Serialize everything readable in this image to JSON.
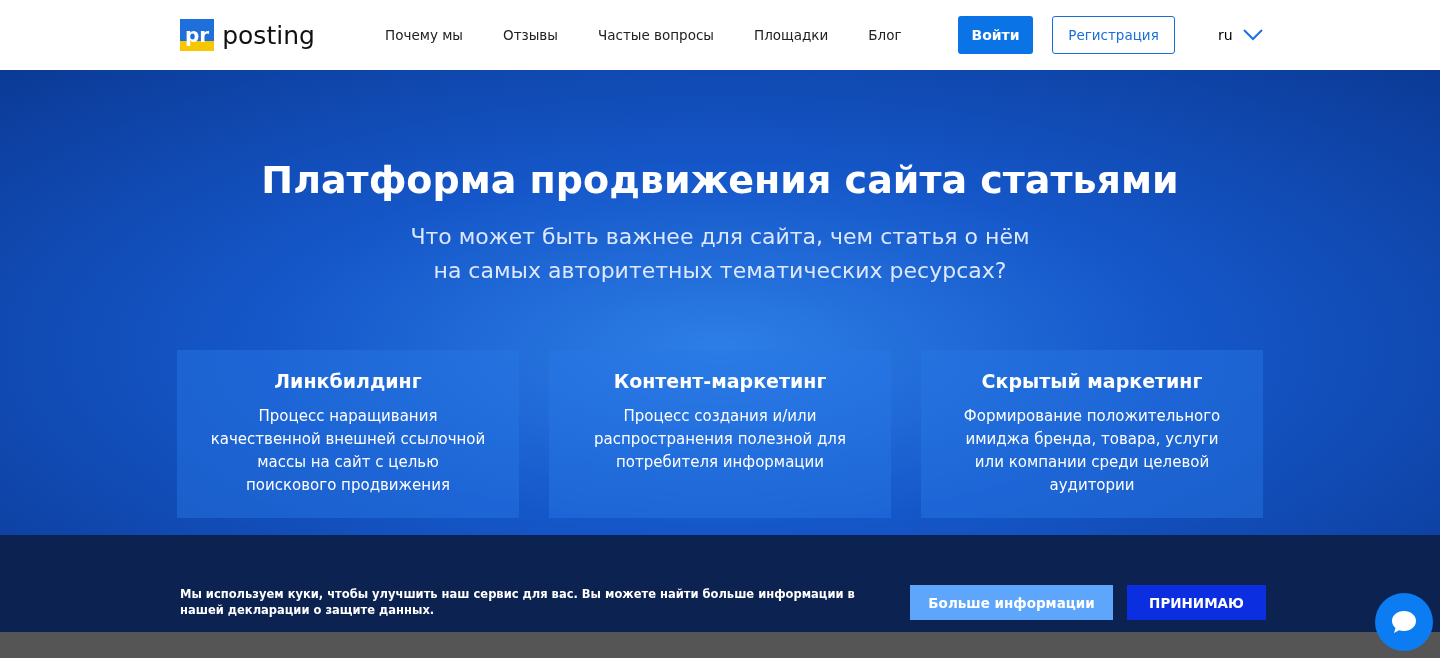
{
  "header": {
    "logo": {
      "mark": "pr",
      "name": "posting"
    },
    "nav": [
      {
        "label": "Почему мы"
      },
      {
        "label": "Отзывы"
      },
      {
        "label": "Частые вопросы"
      },
      {
        "label": "Площадки"
      },
      {
        "label": "Блог"
      }
    ],
    "login": "Войти",
    "register": "Регистрация",
    "language": "ru"
  },
  "hero": {
    "title": "Платформа продвижения сайта статьями",
    "subtitle_lines": [
      "Что может быть важнее для сайта, чем статья о нём",
      "на самых авторитетных тематических ресурсах?"
    ],
    "cards": [
      {
        "title": "Линкбилдинг",
        "text": "Процесс наращивания качественной внешней ссылочной массы на сайт с целью поискового продвижения"
      },
      {
        "title": "Контент-маркетинг",
        "text": "Процесс создания и/или распространения полезной для потребителя информации"
      },
      {
        "title": "Скрытый маркетинг",
        "text": "Формирование положительного имиджа бренда, товара, услуги или компании среди целевой аудитории"
      }
    ]
  },
  "cookie_banner": {
    "text": "Мы используем куки, чтобы улучшить наш сервис для вас. Вы можете найти больше информации в нашей декларации о защите данных.",
    "more_button": "Больше информации",
    "accept_button": "ПРИНИМАЮ"
  }
}
